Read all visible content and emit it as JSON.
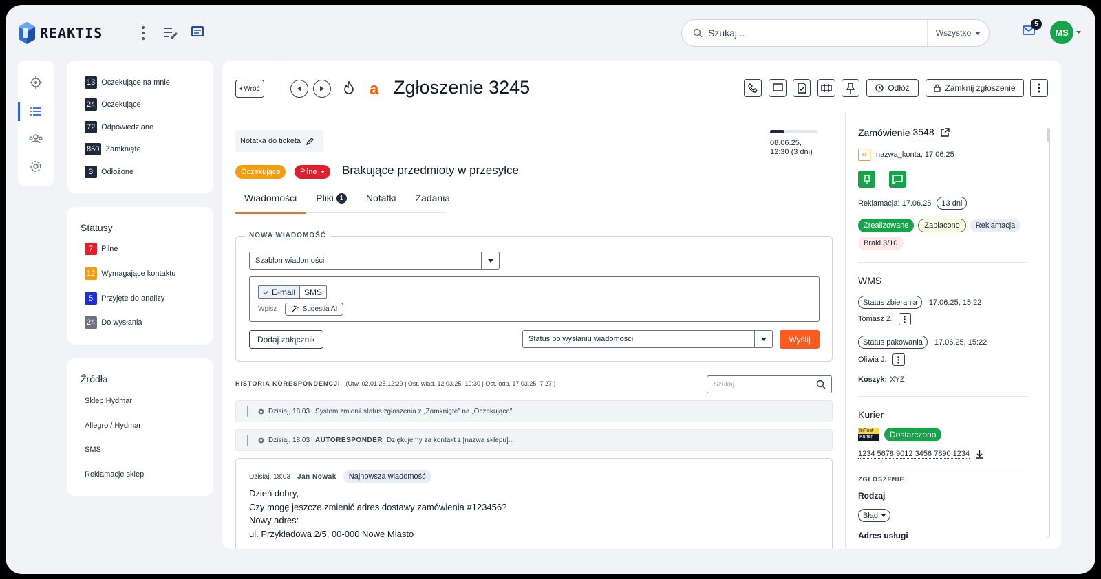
{
  "app": {
    "name": "REAKTIS"
  },
  "search": {
    "placeholder": "Szukaj...",
    "scope": "Wszystko"
  },
  "mail": {
    "count": "5"
  },
  "user": {
    "initials": "MS"
  },
  "queues": [
    {
      "count": "13",
      "label": "Oczekujące na mnie"
    },
    {
      "count": "24",
      "label": "Oczekujące"
    },
    {
      "count": "72",
      "label": "Odpowiedziane"
    },
    {
      "count": "850",
      "label": "Zamknięte"
    },
    {
      "count": "3",
      "label": "Odłożone"
    }
  ],
  "statuses": {
    "title": "Statusy",
    "items": [
      {
        "count": "7",
        "label": "Pilne",
        "color": "#e11d2e"
      },
      {
        "count": "12",
        "label": "Wymagające kontaktu",
        "color": "#f59e0b"
      },
      {
        "count": "5",
        "label": "Przyjęte do analizy",
        "color": "#1d2fd9"
      },
      {
        "count": "24",
        "label": "Do wysłania",
        "color": "#6b7280"
      }
    ]
  },
  "sources": {
    "title": "Źródła",
    "items": [
      "Sklep Hydmar",
      "Allegro / Hydmar",
      "SMS",
      "Reklamacje sklep"
    ]
  },
  "ticket": {
    "back": "Wróć",
    "title_prefix": "Zgłoszenie",
    "number": "3245",
    "snooze": "Odłóż",
    "close": "Zamknij zgłoszenie",
    "note": "Notatka do ticketa",
    "status": "Oczekujące",
    "priority": "Pilne",
    "subject": "Brakujące przedmioty w przesyłce",
    "deadline_date": "08.06.25,",
    "deadline_time": "12:30 (3 dni)",
    "deadline_progress": 0.3
  },
  "tabs": [
    {
      "label": "Wiadomości"
    },
    {
      "label": "Pliki",
      "badge": "1"
    },
    {
      "label": "Notatki"
    },
    {
      "label": "Zadania"
    }
  ],
  "compose": {
    "legend": "NOWA WIADOMOŚĆ",
    "template": "Szablon wiadomości",
    "channel_email": "E-mail",
    "channel_sms": "SMS",
    "placeholder": "Wpisz",
    "ai": "Sugestia AI",
    "attach": "Dodaj załącznik",
    "after_status": "Status po wysłaniu wiadomości",
    "send": "Wyślij"
  },
  "history": {
    "title": "HISTORIA KORESPONDENCJI",
    "meta": "(Utw. 02.01.25,12:29 | Ost. wiad. 12.03.25, 10:30 | Ost. odp. 17.03.25, 7:27 )",
    "search_placeholder": "Szukaj",
    "rows": [
      {
        "time": "Dzisiaj, 18:03",
        "author": "",
        "text": "System zmienił status zgłoszenia z „Zamknięte” na „Oczekujące”"
      },
      {
        "time": "Dzisiaj, 18:03",
        "author": "AUTORESPONDER",
        "text": "Dziękujemy za kontakt z [nazwa sklepu]...."
      }
    ],
    "message": {
      "time": "Dzisiaj, 18:03",
      "author": "Jan Nowak",
      "tag": "Najnowsza wiadomość",
      "lines": [
        "Dzień dobry,",
        "Czy mogę jeszcze zmienić adres dostawy zamówienia #123456?",
        "Nowy adres:",
        "ul. Przykładowa 2/5, 00-000 Nowe Miasto"
      ]
    }
  },
  "order": {
    "title": "Zamówienie",
    "number": "3548",
    "account_logo": "all",
    "account": "nazwa_konta, 17.06.25",
    "complaint": "Reklamacja: 17.06.25",
    "days": "13 dni",
    "tags": [
      "Zrealizowane",
      "Zapłacono",
      "Reklamacja",
      "Braki 3/10"
    ]
  },
  "wms": {
    "title": "WMS",
    "pick_status": "Status zbierania",
    "pick_time": "17.06.25, 15:22",
    "pick_user": "Tomasz Z.",
    "pack_status": "Status pakowania",
    "pack_time": "17.06.25, 15:22",
    "pack_user": "Oliwia J.",
    "cart_label": "Koszyk:",
    "cart_value": "XYZ"
  },
  "courier": {
    "title": "Kurier",
    "logo_top": "InPost",
    "logo_bottom": "Kurier",
    "status": "Dostarczono",
    "tracking": "1234 5678 9012 3456 7890 1234"
  },
  "request": {
    "section": "ZGŁOSZENIE",
    "type_label": "Rodzaj",
    "type_value": "Błąd",
    "address_label": "Adres usługi"
  },
  "colors": {
    "accent": "#f97316",
    "send": "#fe5a1d",
    "green": "#16a34a",
    "navy": "#1e293b"
  }
}
